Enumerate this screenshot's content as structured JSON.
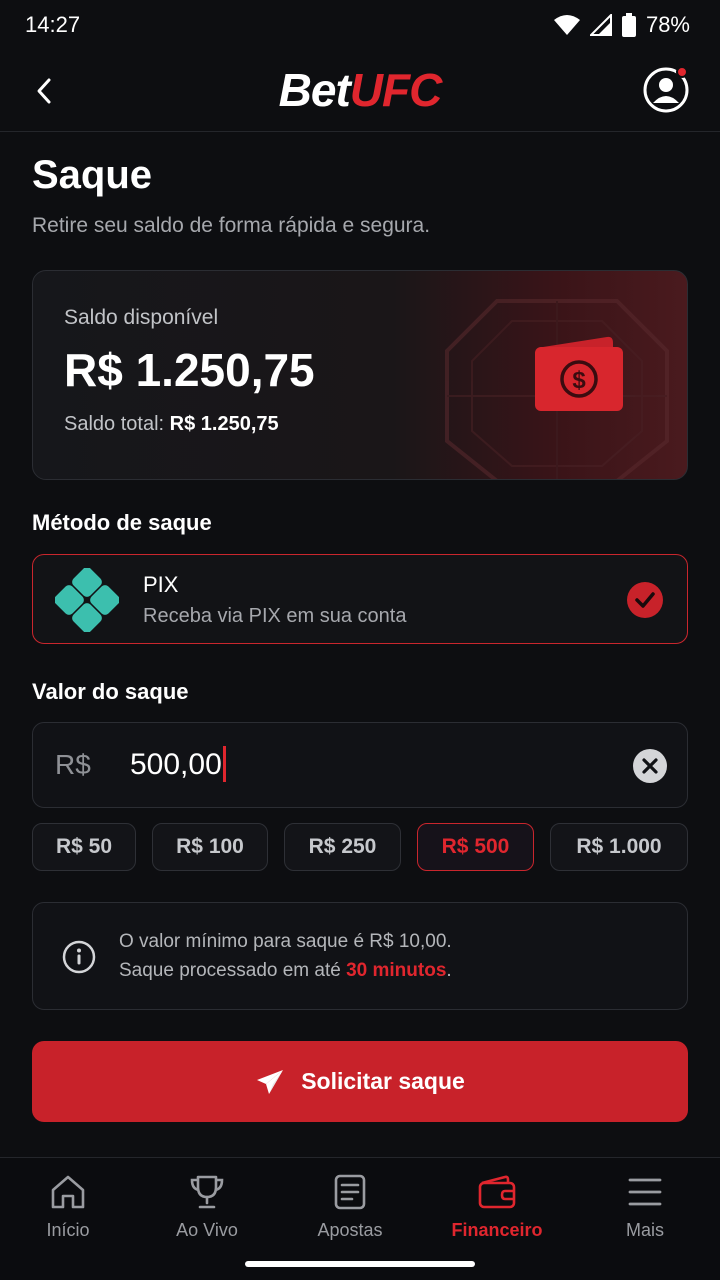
{
  "status_bar": {
    "time": "14:27",
    "battery": "78%"
  },
  "header": {
    "logo_bet": "Bet",
    "logo_ufc": "UFC"
  },
  "page": {
    "title": "Saque",
    "subtitle": "Retire seu saldo de forma rápida e segura."
  },
  "balance": {
    "label": "Saldo disponível",
    "value": "R$ 1.250,75",
    "total_label": "Saldo total:",
    "total_value": "R$ 1.250,75"
  },
  "method": {
    "section_label": "Método de saque",
    "name": "PIX",
    "description": "Receba via PIX em sua conta",
    "selected": true
  },
  "amount": {
    "section_label": "Valor do saque",
    "currency": "R$",
    "value": "500,00"
  },
  "quick_amounts": [
    {
      "label": "R$ 50",
      "active": false
    },
    {
      "label": "R$ 100",
      "active": false
    },
    {
      "label": "R$ 250",
      "active": false
    },
    {
      "label": "R$ 500",
      "active": true
    },
    {
      "label": "R$ 1.000",
      "active": false
    }
  ],
  "info": {
    "line1": "O valor mínimo para saque é R$ 10,00.",
    "line2_prefix": "Saque processado em até ",
    "line2_highlight": "30 minutos",
    "line2_suffix": "."
  },
  "submit": {
    "label": "Solicitar saque"
  },
  "bottom_nav": [
    {
      "label": "Início",
      "icon": "home-icon",
      "active": false
    },
    {
      "label": "Ao Vivo",
      "icon": "trophy-icon",
      "active": false
    },
    {
      "label": "Apostas",
      "icon": "ticket-icon",
      "active": false
    },
    {
      "label": "Financeiro",
      "icon": "wallet-icon",
      "active": true
    },
    {
      "label": "Mais",
      "icon": "menu-icon",
      "active": false
    }
  ],
  "colors": {
    "accent": "#e0262e",
    "button": "#c8222a",
    "background": "#0d0e11",
    "pix": "#3cbfae"
  }
}
